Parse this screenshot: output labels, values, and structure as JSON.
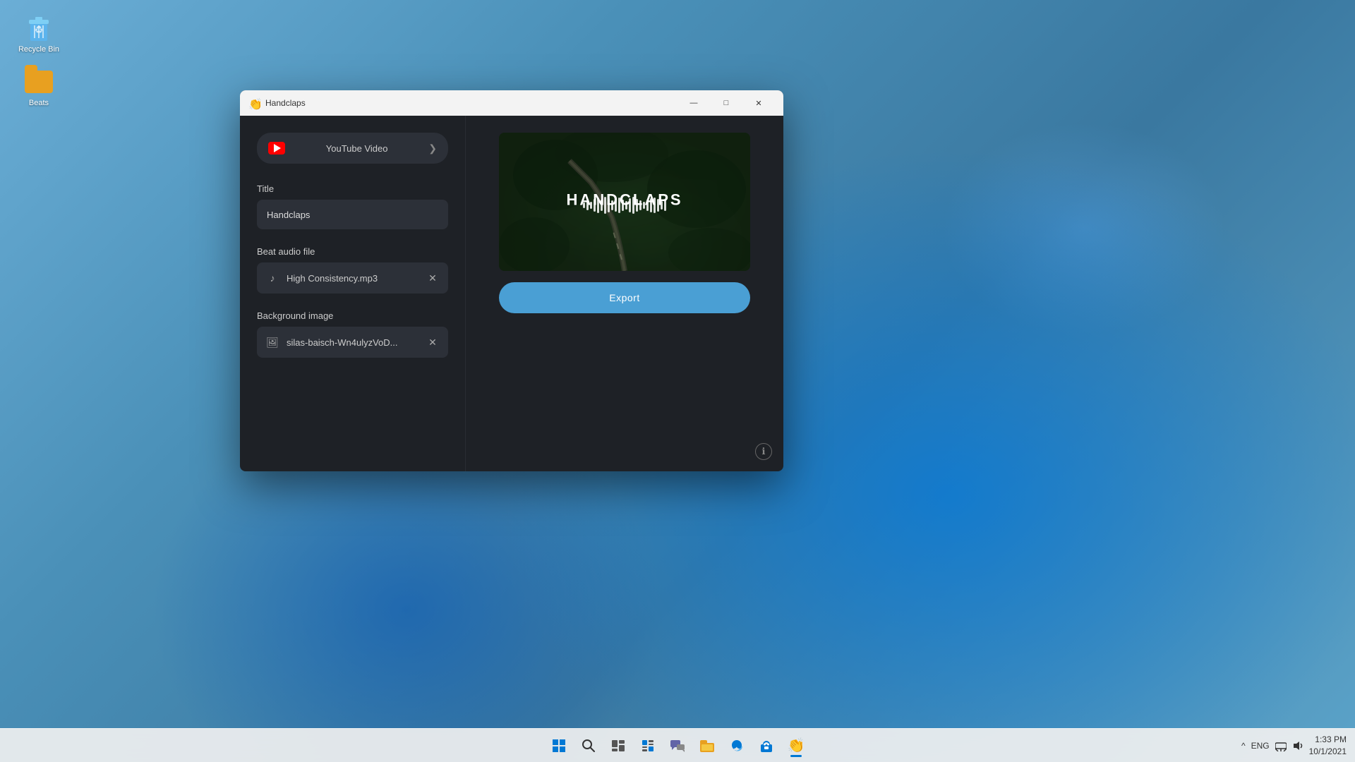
{
  "desktop": {
    "icons": [
      {
        "id": "recycle-bin",
        "label": "Recycle Bin",
        "type": "recycle"
      },
      {
        "id": "beats-folder",
        "label": "Beats",
        "type": "folder"
      }
    ]
  },
  "taskbar": {
    "center_icons": [
      {
        "id": "start",
        "icon": "⊞",
        "label": "Start"
      },
      {
        "id": "search",
        "icon": "🔍",
        "label": "Search"
      },
      {
        "id": "task-view",
        "icon": "▣",
        "label": "Task View"
      },
      {
        "id": "widgets",
        "icon": "⬡",
        "label": "Widgets"
      },
      {
        "id": "chat",
        "icon": "💬",
        "label": "Chat"
      },
      {
        "id": "explorer",
        "icon": "📁",
        "label": "File Explorer"
      },
      {
        "id": "edge",
        "icon": "🌐",
        "label": "Microsoft Edge"
      },
      {
        "id": "store",
        "icon": "🛍",
        "label": "Microsoft Store"
      },
      {
        "id": "handclaps-app",
        "icon": "👏",
        "label": "Handclaps",
        "active": true
      }
    ],
    "systray": {
      "chevron": "^",
      "eng_label": "ENG",
      "time": "1:33 PM",
      "date": "10/1/2021"
    }
  },
  "window": {
    "title": "Handclaps",
    "title_icon": "👏",
    "controls": {
      "minimize": "—",
      "maximize": "□",
      "close": "✕"
    },
    "left_panel": {
      "youtube_btn": {
        "label": "YouTube Video",
        "chevron": "❯"
      },
      "title_field": {
        "label": "Title",
        "value": "Handclaps"
      },
      "audio_field": {
        "label": "Beat audio file",
        "filename": "High Consistency.mp3"
      },
      "image_field": {
        "label": "Background image",
        "filename": "silas-baisch-Wn4ulyzVoD..."
      }
    },
    "right_panel": {
      "preview_title": "HANDCLAPS",
      "export_label": "Export",
      "waveform_heights": [
        8,
        14,
        10,
        18,
        22,
        16,
        24,
        20,
        14,
        18,
        22,
        16,
        12,
        20,
        24,
        18,
        14,
        10,
        16,
        20,
        22,
        18,
        12,
        16
      ],
      "info_icon": "ℹ"
    }
  }
}
